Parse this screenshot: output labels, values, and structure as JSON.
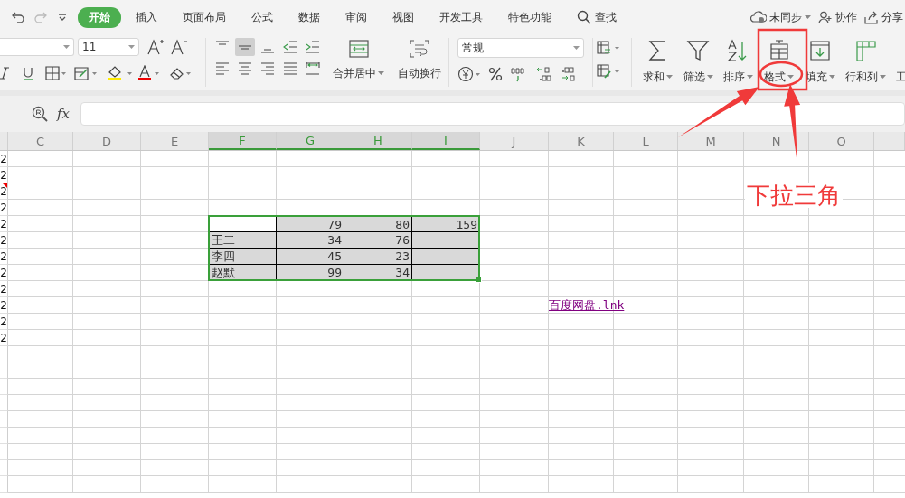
{
  "menu_tabs": [
    {
      "label": "开始",
      "selected": true
    },
    {
      "label": "插入",
      "selected": false
    },
    {
      "label": "页面布局",
      "selected": false
    },
    {
      "label": "公式",
      "selected": false
    },
    {
      "label": "数据",
      "selected": false
    },
    {
      "label": "审阅",
      "selected": false
    },
    {
      "label": "视图",
      "selected": false
    },
    {
      "label": "开发工具",
      "selected": false
    },
    {
      "label": "特色功能",
      "selected": false
    }
  ],
  "search": {
    "label": "查找"
  },
  "account_actions": [
    {
      "label": "未同步",
      "kind": "sync"
    },
    {
      "label": "协作",
      "kind": "collab"
    },
    {
      "label": "分享",
      "kind": "share"
    }
  ],
  "ribbon": {
    "font_size": "11",
    "alignment": [
      {
        "kind": "top",
        "selected": false
      },
      {
        "kind": "middle",
        "selected": true
      },
      {
        "kind": "bottom",
        "selected": false
      },
      {
        "kind": "outdent",
        "selected": false
      },
      {
        "kind": "indent",
        "selected": false
      },
      {
        "kind": "left",
        "selected": false
      },
      {
        "kind": "center",
        "selected": false
      },
      {
        "kind": "right",
        "selected": false
      },
      {
        "kind": "justify",
        "selected": false
      },
      {
        "kind": "distributed",
        "selected": false
      }
    ],
    "merge_buttons": [
      {
        "label": "合并居中",
        "kind": "merge"
      },
      {
        "label": "自动换行",
        "kind": "wrap"
      }
    ],
    "number_format": "常规",
    "tools": [
      {
        "label": "求和",
        "kind": "sum"
      },
      {
        "label": "筛选",
        "kind": "filter"
      },
      {
        "label": "排序",
        "kind": "sort"
      },
      {
        "label": "格式",
        "kind": "format"
      },
      {
        "label": "填充",
        "kind": "fill"
      },
      {
        "label": "行和列",
        "kind": "rows"
      },
      {
        "label": "工",
        "kind": "sheet"
      }
    ]
  },
  "formula_bar": {
    "fx": "fx"
  },
  "sheet": {
    "columns": [
      {
        "letter": "C",
        "selected": false
      },
      {
        "letter": "D",
        "selected": false
      },
      {
        "letter": "E",
        "selected": false
      },
      {
        "letter": "F",
        "selected": true
      },
      {
        "letter": "G",
        "selected": true
      },
      {
        "letter": "H",
        "selected": true
      },
      {
        "letter": "I",
        "selected": true
      },
      {
        "letter": "J",
        "selected": false
      },
      {
        "letter": "K",
        "selected": false
      },
      {
        "letter": "L",
        "selected": false
      },
      {
        "letter": "M",
        "selected": false
      },
      {
        "letter": "N",
        "selected": false
      },
      {
        "letter": "O",
        "selected": false
      }
    ],
    "row_labels": [
      {
        "text": "2",
        "comment": false
      },
      {
        "text": "2",
        "comment": false
      },
      {
        "text": "2",
        "comment": true
      },
      {
        "text": "2",
        "comment": false
      },
      {
        "text": "2",
        "comment": false
      },
      {
        "text": "2",
        "comment": false
      },
      {
        "text": "2",
        "comment": false
      },
      {
        "text": "2",
        "comment": false
      },
      {
        "text": "2",
        "comment": false
      },
      {
        "text": "2",
        "comment": false
      },
      {
        "text": "2",
        "comment": false
      },
      {
        "text": "2",
        "comment": false
      }
    ],
    "table": [
      [
        {
          "filled": false
        },
        {
          "text": "79",
          "filled": true
        },
        {
          "text": "80",
          "filled": true
        },
        {
          "text": "159",
          "filled": true
        }
      ],
      [
        {
          "text": "王二",
          "filled": true
        },
        {
          "text": "34",
          "filled": true
        },
        {
          "text": "76",
          "filled": true
        },
        {
          "filled": true
        }
      ],
      [
        {
          "text": "李四",
          "filled": true
        },
        {
          "text": "45",
          "filled": true
        },
        {
          "text": "23",
          "filled": true
        },
        {
          "filled": true
        }
      ],
      [
        {
          "text": "赵默",
          "filled": true
        },
        {
          "text": "99",
          "filled": true
        },
        {
          "text": "34",
          "filled": true
        },
        {
          "filled": true
        }
      ]
    ],
    "link": "百度网盘.lnk"
  },
  "annotation": {
    "text": "下拉三角"
  }
}
